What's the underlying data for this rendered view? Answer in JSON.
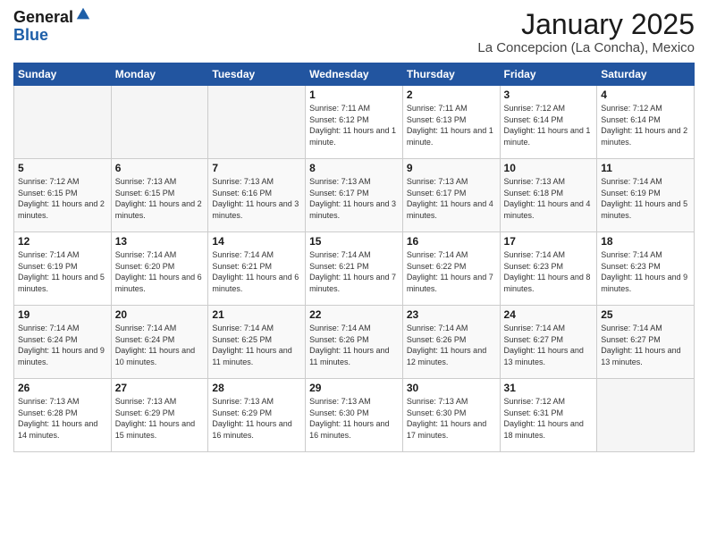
{
  "header": {
    "logo_general": "General",
    "logo_blue": "Blue",
    "month_title": "January 2025",
    "location": "La Concepcion (La Concha), Mexico"
  },
  "weekdays": [
    "Sunday",
    "Monday",
    "Tuesday",
    "Wednesday",
    "Thursday",
    "Friday",
    "Saturday"
  ],
  "weeks": [
    [
      {
        "day": "",
        "sunrise": "",
        "sunset": "",
        "daylight": ""
      },
      {
        "day": "",
        "sunrise": "",
        "sunset": "",
        "daylight": ""
      },
      {
        "day": "",
        "sunrise": "",
        "sunset": "",
        "daylight": ""
      },
      {
        "day": "1",
        "sunrise": "Sunrise: 7:11 AM",
        "sunset": "Sunset: 6:12 PM",
        "daylight": "Daylight: 11 hours and 1 minute."
      },
      {
        "day": "2",
        "sunrise": "Sunrise: 7:11 AM",
        "sunset": "Sunset: 6:13 PM",
        "daylight": "Daylight: 11 hours and 1 minute."
      },
      {
        "day": "3",
        "sunrise": "Sunrise: 7:12 AM",
        "sunset": "Sunset: 6:14 PM",
        "daylight": "Daylight: 11 hours and 1 minute."
      },
      {
        "day": "4",
        "sunrise": "Sunrise: 7:12 AM",
        "sunset": "Sunset: 6:14 PM",
        "daylight": "Daylight: 11 hours and 2 minutes."
      }
    ],
    [
      {
        "day": "5",
        "sunrise": "Sunrise: 7:12 AM",
        "sunset": "Sunset: 6:15 PM",
        "daylight": "Daylight: 11 hours and 2 minutes."
      },
      {
        "day": "6",
        "sunrise": "Sunrise: 7:13 AM",
        "sunset": "Sunset: 6:15 PM",
        "daylight": "Daylight: 11 hours and 2 minutes."
      },
      {
        "day": "7",
        "sunrise": "Sunrise: 7:13 AM",
        "sunset": "Sunset: 6:16 PM",
        "daylight": "Daylight: 11 hours and 3 minutes."
      },
      {
        "day": "8",
        "sunrise": "Sunrise: 7:13 AM",
        "sunset": "Sunset: 6:17 PM",
        "daylight": "Daylight: 11 hours and 3 minutes."
      },
      {
        "day": "9",
        "sunrise": "Sunrise: 7:13 AM",
        "sunset": "Sunset: 6:17 PM",
        "daylight": "Daylight: 11 hours and 4 minutes."
      },
      {
        "day": "10",
        "sunrise": "Sunrise: 7:13 AM",
        "sunset": "Sunset: 6:18 PM",
        "daylight": "Daylight: 11 hours and 4 minutes."
      },
      {
        "day": "11",
        "sunrise": "Sunrise: 7:14 AM",
        "sunset": "Sunset: 6:19 PM",
        "daylight": "Daylight: 11 hours and 5 minutes."
      }
    ],
    [
      {
        "day": "12",
        "sunrise": "Sunrise: 7:14 AM",
        "sunset": "Sunset: 6:19 PM",
        "daylight": "Daylight: 11 hours and 5 minutes."
      },
      {
        "day": "13",
        "sunrise": "Sunrise: 7:14 AM",
        "sunset": "Sunset: 6:20 PM",
        "daylight": "Daylight: 11 hours and 6 minutes."
      },
      {
        "day": "14",
        "sunrise": "Sunrise: 7:14 AM",
        "sunset": "Sunset: 6:21 PM",
        "daylight": "Daylight: 11 hours and 6 minutes."
      },
      {
        "day": "15",
        "sunrise": "Sunrise: 7:14 AM",
        "sunset": "Sunset: 6:21 PM",
        "daylight": "Daylight: 11 hours and 7 minutes."
      },
      {
        "day": "16",
        "sunrise": "Sunrise: 7:14 AM",
        "sunset": "Sunset: 6:22 PM",
        "daylight": "Daylight: 11 hours and 7 minutes."
      },
      {
        "day": "17",
        "sunrise": "Sunrise: 7:14 AM",
        "sunset": "Sunset: 6:23 PM",
        "daylight": "Daylight: 11 hours and 8 minutes."
      },
      {
        "day": "18",
        "sunrise": "Sunrise: 7:14 AM",
        "sunset": "Sunset: 6:23 PM",
        "daylight": "Daylight: 11 hours and 9 minutes."
      }
    ],
    [
      {
        "day": "19",
        "sunrise": "Sunrise: 7:14 AM",
        "sunset": "Sunset: 6:24 PM",
        "daylight": "Daylight: 11 hours and 9 minutes."
      },
      {
        "day": "20",
        "sunrise": "Sunrise: 7:14 AM",
        "sunset": "Sunset: 6:24 PM",
        "daylight": "Daylight: 11 hours and 10 minutes."
      },
      {
        "day": "21",
        "sunrise": "Sunrise: 7:14 AM",
        "sunset": "Sunset: 6:25 PM",
        "daylight": "Daylight: 11 hours and 11 minutes."
      },
      {
        "day": "22",
        "sunrise": "Sunrise: 7:14 AM",
        "sunset": "Sunset: 6:26 PM",
        "daylight": "Daylight: 11 hours and 11 minutes."
      },
      {
        "day": "23",
        "sunrise": "Sunrise: 7:14 AM",
        "sunset": "Sunset: 6:26 PM",
        "daylight": "Daylight: 11 hours and 12 minutes."
      },
      {
        "day": "24",
        "sunrise": "Sunrise: 7:14 AM",
        "sunset": "Sunset: 6:27 PM",
        "daylight": "Daylight: 11 hours and 13 minutes."
      },
      {
        "day": "25",
        "sunrise": "Sunrise: 7:14 AM",
        "sunset": "Sunset: 6:27 PM",
        "daylight": "Daylight: 11 hours and 13 minutes."
      }
    ],
    [
      {
        "day": "26",
        "sunrise": "Sunrise: 7:13 AM",
        "sunset": "Sunset: 6:28 PM",
        "daylight": "Daylight: 11 hours and 14 minutes."
      },
      {
        "day": "27",
        "sunrise": "Sunrise: 7:13 AM",
        "sunset": "Sunset: 6:29 PM",
        "daylight": "Daylight: 11 hours and 15 minutes."
      },
      {
        "day": "28",
        "sunrise": "Sunrise: 7:13 AM",
        "sunset": "Sunset: 6:29 PM",
        "daylight": "Daylight: 11 hours and 16 minutes."
      },
      {
        "day": "29",
        "sunrise": "Sunrise: 7:13 AM",
        "sunset": "Sunset: 6:30 PM",
        "daylight": "Daylight: 11 hours and 16 minutes."
      },
      {
        "day": "30",
        "sunrise": "Sunrise: 7:13 AM",
        "sunset": "Sunset: 6:30 PM",
        "daylight": "Daylight: 11 hours and 17 minutes."
      },
      {
        "day": "31",
        "sunrise": "Sunrise: 7:12 AM",
        "sunset": "Sunset: 6:31 PM",
        "daylight": "Daylight: 11 hours and 18 minutes."
      },
      {
        "day": "",
        "sunrise": "",
        "sunset": "",
        "daylight": ""
      }
    ]
  ]
}
